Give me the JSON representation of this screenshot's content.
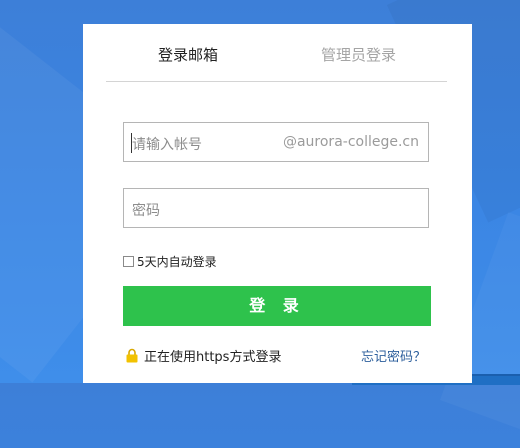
{
  "tabs": {
    "mail_login": "登录邮箱",
    "admin_login": "管理员登录"
  },
  "login_form": {
    "account_placeholder": "请输入帐号",
    "domain_suffix": "@aurora-college.cn",
    "password_placeholder": "密码",
    "remember_label": "5天内自动登录",
    "remember_checked": false,
    "login_button": "登 录"
  },
  "footer": {
    "https_notice": "正在使用https方式登录",
    "forgot_password": "忘记密码？"
  },
  "icons": {
    "lock": "lock-icon"
  },
  "colors": {
    "background": "#3b86e4",
    "login_button": "#2ec24c",
    "link": "#2d5f9c",
    "lock": "#f2c200"
  }
}
